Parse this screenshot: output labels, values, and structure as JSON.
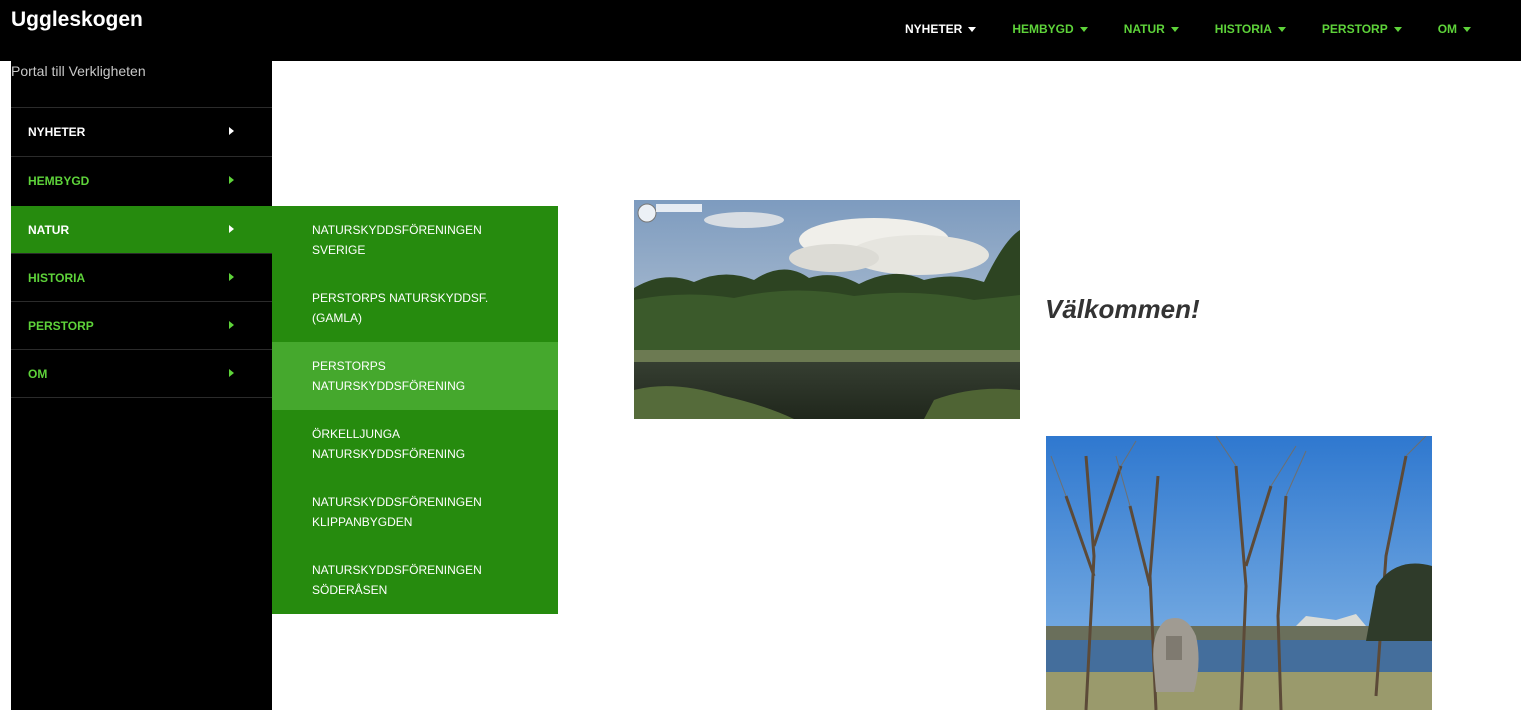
{
  "header": {
    "site_title": "Uggleskogen",
    "tagline": "Portal till Verkligheten"
  },
  "topnav": [
    {
      "label": "NYHETER",
      "color": "#ffffff"
    },
    {
      "label": "HEMBYGD",
      "color": "#5ed33a"
    },
    {
      "label": "NATUR",
      "color": "#5ed33a"
    },
    {
      "label": "HISTORIA",
      "color": "#5ed33a"
    },
    {
      "label": "PERSTORP",
      "color": "#5ed33a"
    },
    {
      "label": "OM",
      "color": "#5ed33a"
    }
  ],
  "sidebar": {
    "items": [
      {
        "label": "NYHETER"
      },
      {
        "label": "HEMBYGD"
      },
      {
        "label": "NATUR",
        "active": true
      },
      {
        "label": "HISTORIA"
      },
      {
        "label": "PERSTORP"
      },
      {
        "label": "OM"
      }
    ]
  },
  "submenu": {
    "items": [
      {
        "line1": "NATURSKYDDSFÖRENINGEN",
        "line2": "SVERIGE"
      },
      {
        "line1": "PERSTORPS NATURSKYDDSF.",
        "line2": "(GAMLA)"
      },
      {
        "line1": "PERSTORPS",
        "line2": "NATURSKYDDSFÖRENING",
        "highlighted": true
      },
      {
        "line1": "ÖRKELLJUNGA",
        "line2": "NATURSKYDDSFÖRENING"
      },
      {
        "line1": "NATURSKYDDSFÖRENINGEN",
        "line2": "KLIPPANBYGDEN"
      },
      {
        "line1": "NATURSKYDDSFÖRENINGEN",
        "line2": "SÖDERÅSEN"
      }
    ]
  },
  "main": {
    "welcome": "Välkommen!"
  },
  "colors": {
    "accent_green": "#268b0e",
    "highlight_green": "#45a82d",
    "nav_green": "#5ed33a",
    "background_dark": "#000000"
  }
}
